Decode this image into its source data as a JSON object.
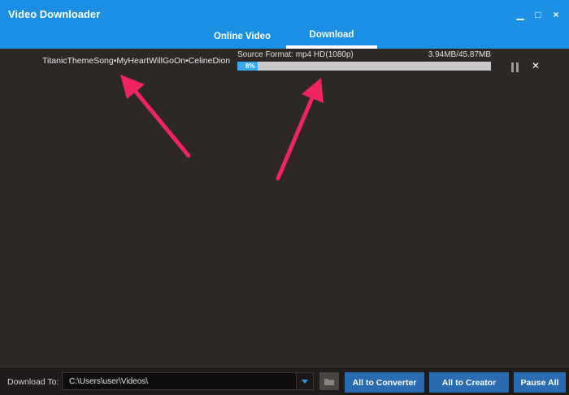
{
  "window": {
    "title": "Video Downloader",
    "controls": {
      "minimize": "▁",
      "maximize": "□",
      "close": "×"
    }
  },
  "tabs": [
    {
      "label": "Online Video",
      "active": false
    },
    {
      "label": "Download",
      "active": true
    }
  ],
  "download_item": {
    "title": "TitanicThemeSong•MyHeartWillGoOn•CelineDion",
    "source_format": "Source Format: mp4 HD(1080p)",
    "size": "3.94MB/45.87MB",
    "progress_label": "8%",
    "progress_fraction": 0.08
  },
  "bottom_bar": {
    "download_to_label": "Download To:",
    "path_value": "C:\\Users\\user\\Videos\\",
    "buttons": {
      "to_converter": "All to Converter",
      "to_creator": "All to Creator",
      "pause_all": "Pause All"
    }
  },
  "colors": {
    "title_bar": "#1b8fe3",
    "body": "#2d2725",
    "progress_fill": "#3aa9ee",
    "annotation_arrow": "#f0245f",
    "button": "#2a6cb0"
  }
}
